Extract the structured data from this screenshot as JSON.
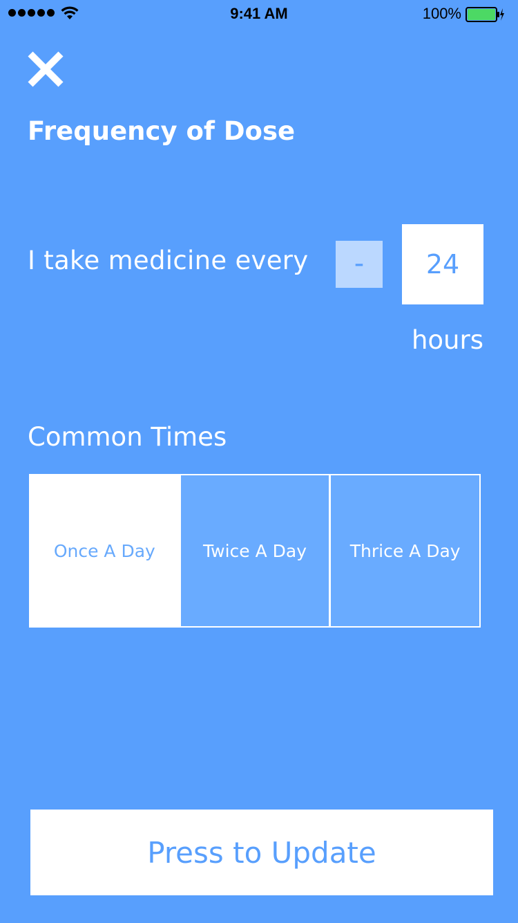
{
  "status_bar": {
    "time": "9:41 AM",
    "battery_percent": "100%",
    "signal_icon": "signal-dots-icon",
    "wifi_icon": "wifi-icon",
    "battery_icon": "battery-charging-icon"
  },
  "header": {
    "close_icon": "close-icon",
    "title": "Frequency of Dose"
  },
  "dose": {
    "sentence": "I take medicine every",
    "decrement_label": "-",
    "hours_value": "24",
    "unit": "hours"
  },
  "common_times": {
    "title": "Common Times",
    "options": [
      {
        "label": "Once A Day",
        "selected": true
      },
      {
        "label": "Twice A Day",
        "selected": false
      },
      {
        "label": "Thrice A Day",
        "selected": false
      }
    ]
  },
  "footer": {
    "update_label": "Press to Update"
  },
  "colors": {
    "background": "#589ffd",
    "accent_light": "#bbd8ff",
    "option_unselected": "#69abff",
    "battery_green": "#4cd964"
  }
}
